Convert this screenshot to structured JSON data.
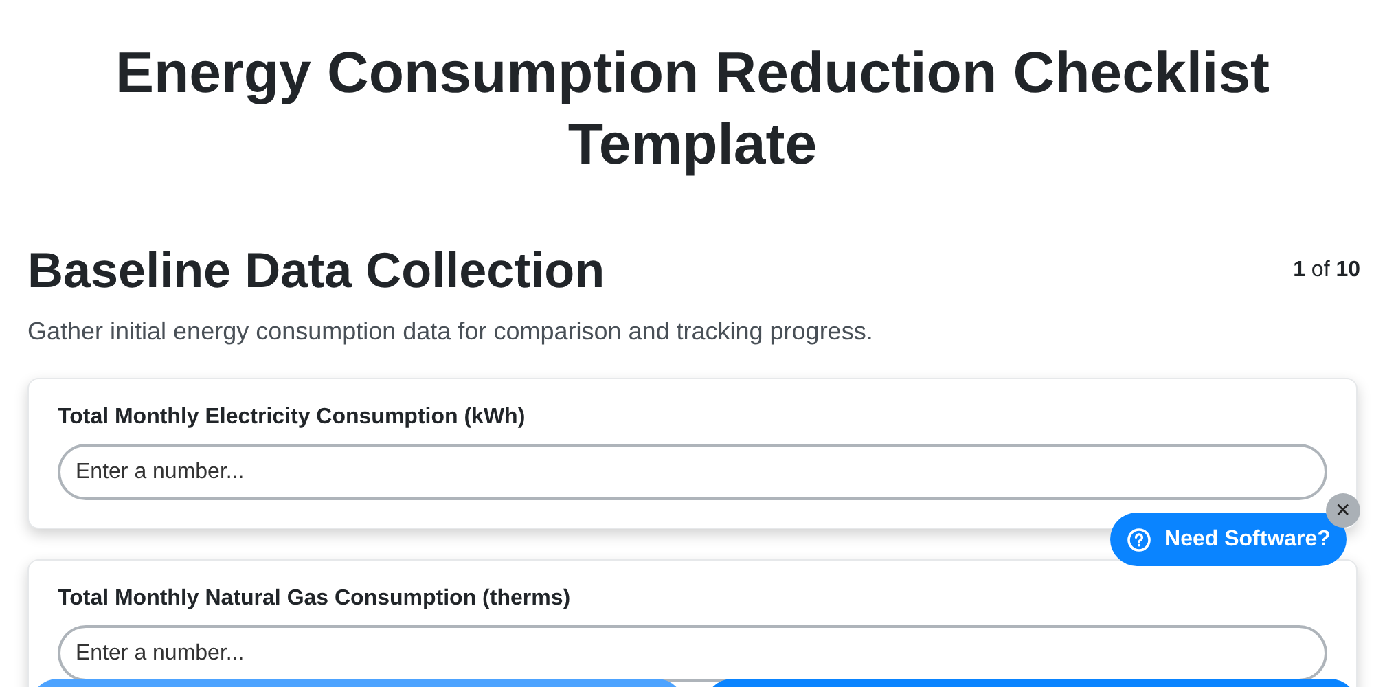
{
  "title": "Energy Consumption Reduction Checklist Template",
  "section": {
    "heading": "Baseline Data Collection",
    "progress": "**1** of **10**",
    "description": "Gather initial energy consumption data for comparison and tracking progress."
  },
  "questions": [
    {
      "label": "Total Monthly Electricity Consumption (kWh)",
      "placeholder": "Enter a number..."
    },
    {
      "label": "Total Monthly Natural Gas Consumption (therms)",
      "placeholder": "Enter a number..."
    }
  ],
  "nav_buttons": [
    {
      "disabled": true
    },
    {
      "disabled": false
    }
  ],
  "help_widget": {
    "label": "Need Software?",
    "close": "✕"
  }
}
